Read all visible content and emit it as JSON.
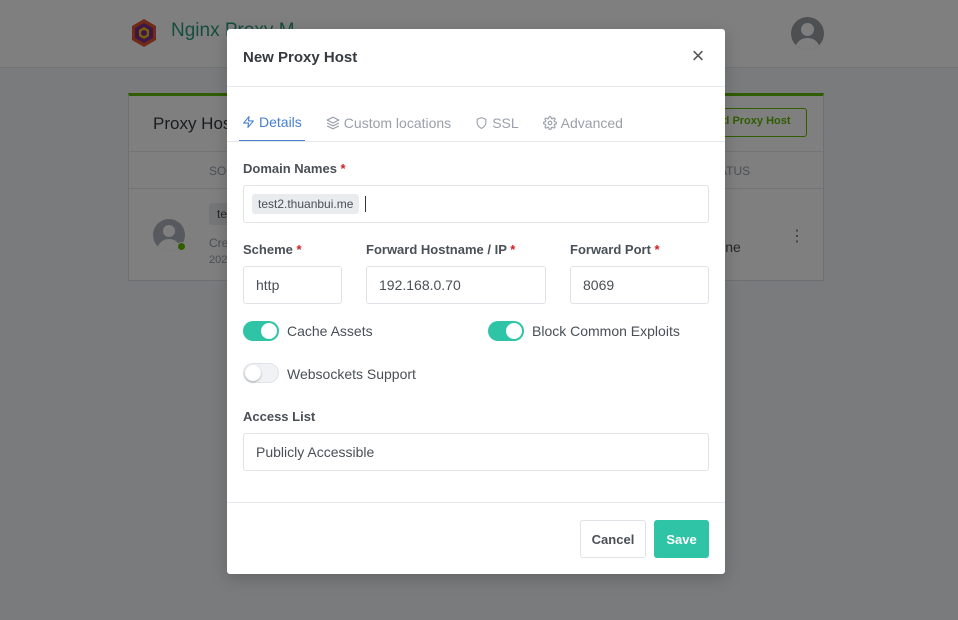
{
  "app": {
    "brand": "Nginx Proxy M",
    "card_title": "Proxy Hos",
    "add_button": "Add Proxy Host",
    "col_source": "SO",
    "col_status": "ATUS",
    "row": {
      "tag": "te",
      "created": "Cre",
      "date": "202",
      "status": "line"
    }
  },
  "modal": {
    "title": "New Proxy Host",
    "tabs": [
      {
        "label": "Details",
        "icon": "bolt-icon",
        "active": true
      },
      {
        "label": "Custom locations",
        "icon": "layers-icon",
        "active": false
      },
      {
        "label": "SSL",
        "icon": "shield-icon",
        "active": false
      },
      {
        "label": "Advanced",
        "icon": "gear-icon",
        "active": false
      }
    ],
    "domain_names": {
      "label": "Domain Names",
      "required": "*",
      "chips": [
        "test2.thuanbui.me"
      ]
    },
    "scheme": {
      "label": "Scheme",
      "required": "*",
      "value": "http"
    },
    "forward_host": {
      "label": "Forward Hostname / IP",
      "required": "*",
      "value": "192.168.0.70"
    },
    "forward_port": {
      "label": "Forward Port",
      "required": "*",
      "value": "8069"
    },
    "toggles": {
      "cache_assets": {
        "label": "Cache Assets",
        "on": true
      },
      "block_exploits": {
        "label": "Block Common Exploits",
        "on": true
      },
      "websockets": {
        "label": "Websockets Support",
        "on": false
      }
    },
    "access_list": {
      "label": "Access List",
      "value": "Publicly Accessible"
    },
    "buttons": {
      "cancel": "Cancel",
      "save": "Save"
    }
  },
  "colors": {
    "accent_teal": "#2ec4a5",
    "tab_active": "#467fcf",
    "required": "#cd201f",
    "success_green": "#5eba00"
  }
}
